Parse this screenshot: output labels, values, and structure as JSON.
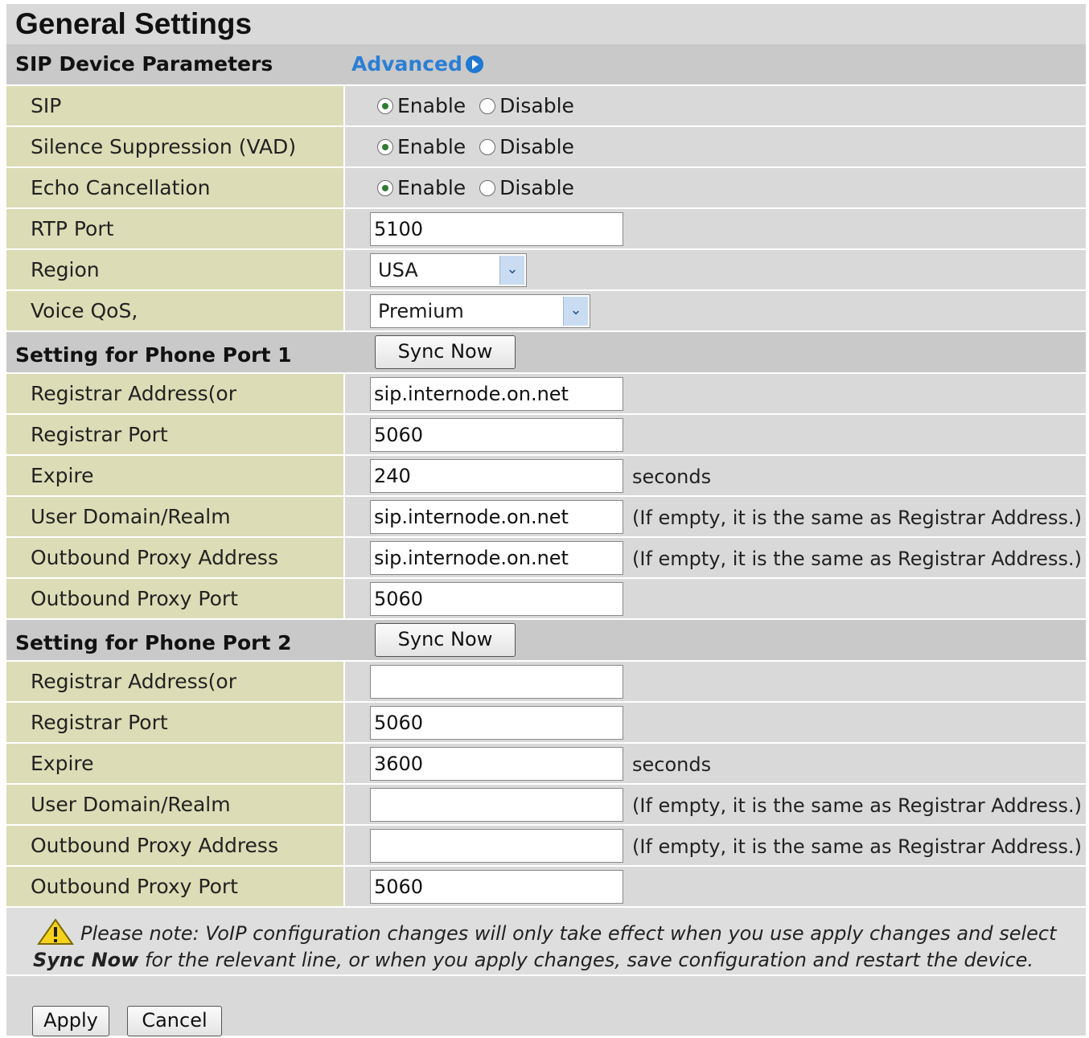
{
  "page": {
    "title": "General Settings"
  },
  "sip_section": {
    "label": "SIP Device Parameters",
    "advanced_label": "Advanced"
  },
  "sip": [
    {
      "label": "SIP",
      "enable": "Enable",
      "disable": "Disable",
      "selected": "Enable"
    },
    {
      "label": "Silence Suppression (VAD)",
      "enable": "Enable",
      "disable": "Disable",
      "selected": "Enable"
    },
    {
      "label": "Echo Cancellation",
      "enable": "Enable",
      "disable": "Disable",
      "selected": "Enable"
    }
  ],
  "rtp_port": {
    "label": "RTP Port",
    "value": "5100"
  },
  "region": {
    "label": "Region",
    "value": "USA"
  },
  "voice_qos": {
    "label": "Voice QoS,",
    "value": "Premium"
  },
  "port1": {
    "label": "Setting for Phone Port 1",
    "sync_label": "Sync Now",
    "registrar_address": {
      "label": "Registrar Address(or Hostname)",
      "value": "sip.internode.on.net"
    },
    "registrar_port": {
      "label": "Registrar Port",
      "value": "5060"
    },
    "expire": {
      "label": "Expire",
      "value": "240",
      "unit": "seconds"
    },
    "user_domain": {
      "label": "User Domain/Realm",
      "value": "sip.internode.on.net",
      "hint": "(If empty, it is the same as Registrar Address.)"
    },
    "outbound_proxy_address": {
      "label": "Outbound Proxy Address",
      "value": "sip.internode.on.net",
      "hint": "(If empty, it is the same as Registrar Address.)"
    },
    "outbound_proxy_port": {
      "label": "Outbound Proxy Port",
      "value": "5060"
    }
  },
  "port2": {
    "label": "Setting for Phone Port 2",
    "sync_label": "Sync Now",
    "registrar_address": {
      "label": "Registrar Address(or Hostname)",
      "value": ""
    },
    "registrar_port": {
      "label": "Registrar Port",
      "value": "5060"
    },
    "expire": {
      "label": "Expire",
      "value": "3600",
      "unit": "seconds"
    },
    "user_domain": {
      "label": "User Domain/Realm",
      "value": "",
      "hint": "(If empty, it is the same as Registrar Address.)"
    },
    "outbound_proxy_address": {
      "label": "Outbound Proxy Address",
      "value": "",
      "hint": "(If empty, it is the same as Registrar Address.)"
    },
    "outbound_proxy_port": {
      "label": "Outbound Proxy Port",
      "value": "5060"
    }
  },
  "note": {
    "line1": "Please note: VoIP configuration changes will only take effect when you use apply changes and select",
    "line2_bold": "Sync Now",
    "line2_rest": " for the relevant line, or when you apply changes, save configuration and restart the device."
  },
  "actions": {
    "apply": "Apply",
    "cancel": "Cancel"
  },
  "colors": {
    "label_bg": "#dcdcb6",
    "value_bg": "#d9d9d9",
    "section_bg": "#c9c9c9",
    "link": "#2b7fd4"
  },
  "icons": {
    "advanced": "arrow-right-circle-icon",
    "warning": "warning-triangle-icon",
    "dropdown": "chevron-down-icon"
  }
}
